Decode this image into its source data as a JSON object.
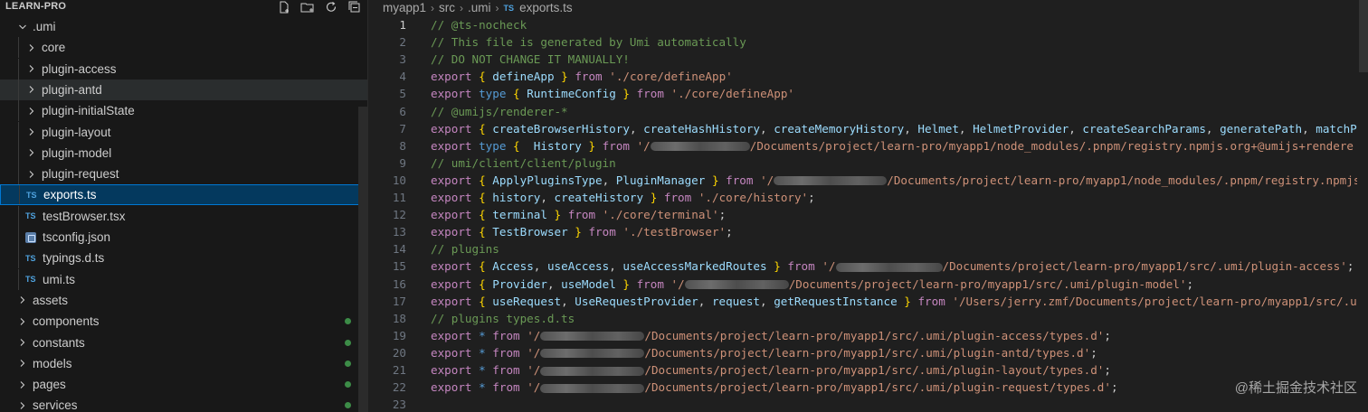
{
  "sidebar": {
    "title": "LEARN-PRO",
    "actions": [
      {
        "icon": "new-file-icon"
      },
      {
        "icon": "new-folder-icon"
      },
      {
        "icon": "refresh-icon"
      },
      {
        "icon": "collapse-all-icon"
      }
    ],
    "tree": [
      {
        "label": ".umi",
        "kind": "folder-open"
      },
      {
        "label": "core",
        "kind": "folder"
      },
      {
        "label": "plugin-access",
        "kind": "folder"
      },
      {
        "label": "plugin-antd",
        "kind": "folder"
      },
      {
        "label": "plugin-initialState",
        "kind": "folder"
      },
      {
        "label": "plugin-layout",
        "kind": "folder"
      },
      {
        "label": "plugin-model",
        "kind": "folder"
      },
      {
        "label": "plugin-request",
        "kind": "folder"
      },
      {
        "label": "exports.ts",
        "kind": "ts",
        "badge": "TS"
      },
      {
        "label": "testBrowser.tsx",
        "kind": "ts",
        "badge": "TS"
      },
      {
        "label": "tsconfig.json",
        "kind": "json"
      },
      {
        "label": "typings.d.ts",
        "kind": "ts",
        "badge": "TS"
      },
      {
        "label": "umi.ts",
        "kind": "ts",
        "badge": "TS"
      },
      {
        "label": "assets",
        "kind": "folder"
      },
      {
        "label": "components",
        "kind": "folder"
      },
      {
        "label": "constants",
        "kind": "folder"
      },
      {
        "label": "models",
        "kind": "folder"
      },
      {
        "label": "pages",
        "kind": "folder"
      },
      {
        "label": "services",
        "kind": "folder"
      }
    ]
  },
  "breadcrumb": {
    "items": [
      "myapp1",
      "src",
      ".umi"
    ],
    "file_badge": "TS",
    "file": "exports.ts"
  },
  "editor": {
    "active_line": 1,
    "lines": [
      {
        "n": "1",
        "html": ""
      },
      {
        "n": "2",
        "html": ""
      },
      {
        "n": "3",
        "html": ""
      },
      {
        "n": "4",
        "html": ""
      },
      {
        "n": "5",
        "html": ""
      },
      {
        "n": "6",
        "html": ""
      },
      {
        "n": "7",
        "html": ""
      },
      {
        "n": "8",
        "html": ""
      },
      {
        "n": "9",
        "html": ""
      },
      {
        "n": "10",
        "html": ""
      },
      {
        "n": "11",
        "html": ""
      },
      {
        "n": "12",
        "html": ""
      },
      {
        "n": "13",
        "html": ""
      },
      {
        "n": "14",
        "html": ""
      },
      {
        "n": "15",
        "html": ""
      },
      {
        "n": "16",
        "html": ""
      },
      {
        "n": "17",
        "html": ""
      },
      {
        "n": "18",
        "html": ""
      },
      {
        "n": "19",
        "html": ""
      },
      {
        "n": "20",
        "html": ""
      },
      {
        "n": "21",
        "html": ""
      },
      {
        "n": "22",
        "html": ""
      },
      {
        "n": "23",
        "html": ""
      }
    ],
    "code": [
      "// @ts-nocheck",
      "// This file is generated by Umi automatically",
      "// DO NOT CHANGE IT MANUALLY!",
      "export { defineApp } from './core/defineApp'",
      "export type { RuntimeConfig } from './core/defineApp'",
      "// @umijs/renderer-*",
      "export { createBrowserHistory, createHashHistory, createMemoryHistory, Helmet, HelmetProvider, createSearchParams, generatePath, matchP",
      "export type {  History } from '/Documents/project/learn-pro/myapp1/node_modules/.pnpm/registry.npmjs.org+@umijs+rendere",
      "// umi/client/client/plugin",
      "export { ApplyPluginsType, PluginManager } from '/Documents/project/learn-pro/myapp1/node_modules/.pnpm/registry.npmjs.",
      "export { history, createHistory } from './core/history';",
      "export { terminal } from './core/terminal';",
      "export { TestBrowser } from './testBrowser';",
      "// plugins",
      "export { Access, useAccess, useAccessMarkedRoutes } from '/Documents/project/learn-pro/myapp1/src/.umi/plugin-access';",
      "export { Provider, useModel } from '/Documents/project/learn-pro/myapp1/src/.umi/plugin-model';",
      "export { useRequest, UseRequestProvider, request, getRequestInstance } from '/Users/jerry.zmf/Documents/project/learn-pro/myapp1/src/.u",
      "// plugins types.d.ts",
      "export * from '/Documents/project/learn-pro/myapp1/src/.umi/plugin-access/types.d';",
      "export * from '/Documents/project/learn-pro/myapp1/src/.umi/plugin-antd/types.d';",
      "export * from '/Documents/project/learn-pro/myapp1/src/.umi/plugin-layout/types.d';",
      "export * from '/Documents/project/learn-pro/myapp1/src/.umi/plugin-request/types.d';",
      ""
    ]
  },
  "watermark": "@稀土掘金技术社区",
  "colors": {
    "comment": "#6a9955",
    "keyword": "#569cd6",
    "string": "#ce9178",
    "identifier": "#9cdcfe",
    "brace": "#ffd700",
    "selection": "#04395e"
  }
}
